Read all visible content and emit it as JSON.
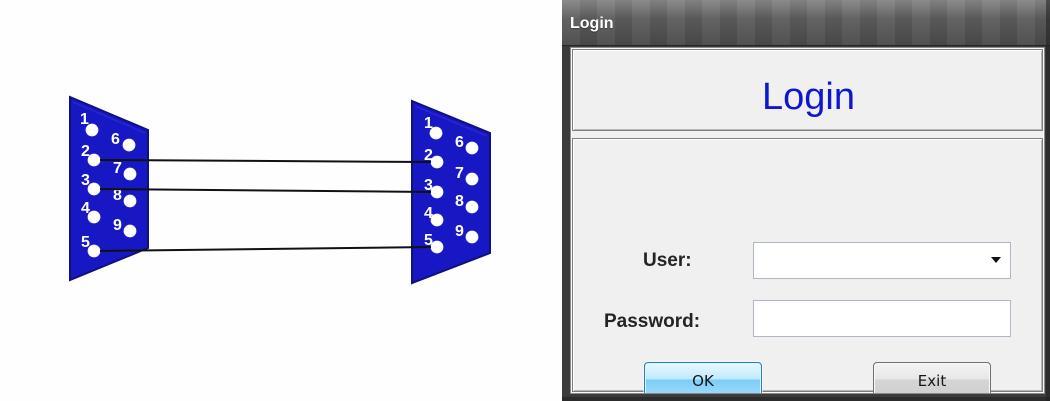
{
  "diagram": {
    "left_connector": {
      "pins": [
        {
          "number": "1"
        },
        {
          "number": "2"
        },
        {
          "number": "3"
        },
        {
          "number": "4"
        },
        {
          "number": "5"
        },
        {
          "number": "6"
        },
        {
          "number": "7"
        },
        {
          "number": "8"
        },
        {
          "number": "9"
        }
      ]
    },
    "right_connector": {
      "pins": [
        {
          "number": "1"
        },
        {
          "number": "2"
        },
        {
          "number": "3"
        },
        {
          "number": "4"
        },
        {
          "number": "5"
        },
        {
          "number": "6"
        },
        {
          "number": "7"
        },
        {
          "number": "8"
        },
        {
          "number": "9"
        }
      ]
    },
    "connections": [
      {
        "from": "2",
        "to": "2"
      },
      {
        "from": "3",
        "to": "3"
      },
      {
        "from": "5",
        "to": "5"
      }
    ]
  },
  "window": {
    "title": "Login",
    "header": {
      "text": "Login"
    },
    "form": {
      "user_label": "User:",
      "password_label": "Password:",
      "user_value": "",
      "password_value": ""
    },
    "buttons": {
      "ok_label": "OK",
      "exit_label": "Exit"
    }
  },
  "colors": {
    "connector_fill": "#1717c4",
    "connector_stroke": "#10107f",
    "pin_fill": "#ffffff",
    "header_text": "#0d17cf",
    "window_title_text": "#ffffff"
  },
  "icons": {
    "dropdown": "chevron-down-icon"
  }
}
